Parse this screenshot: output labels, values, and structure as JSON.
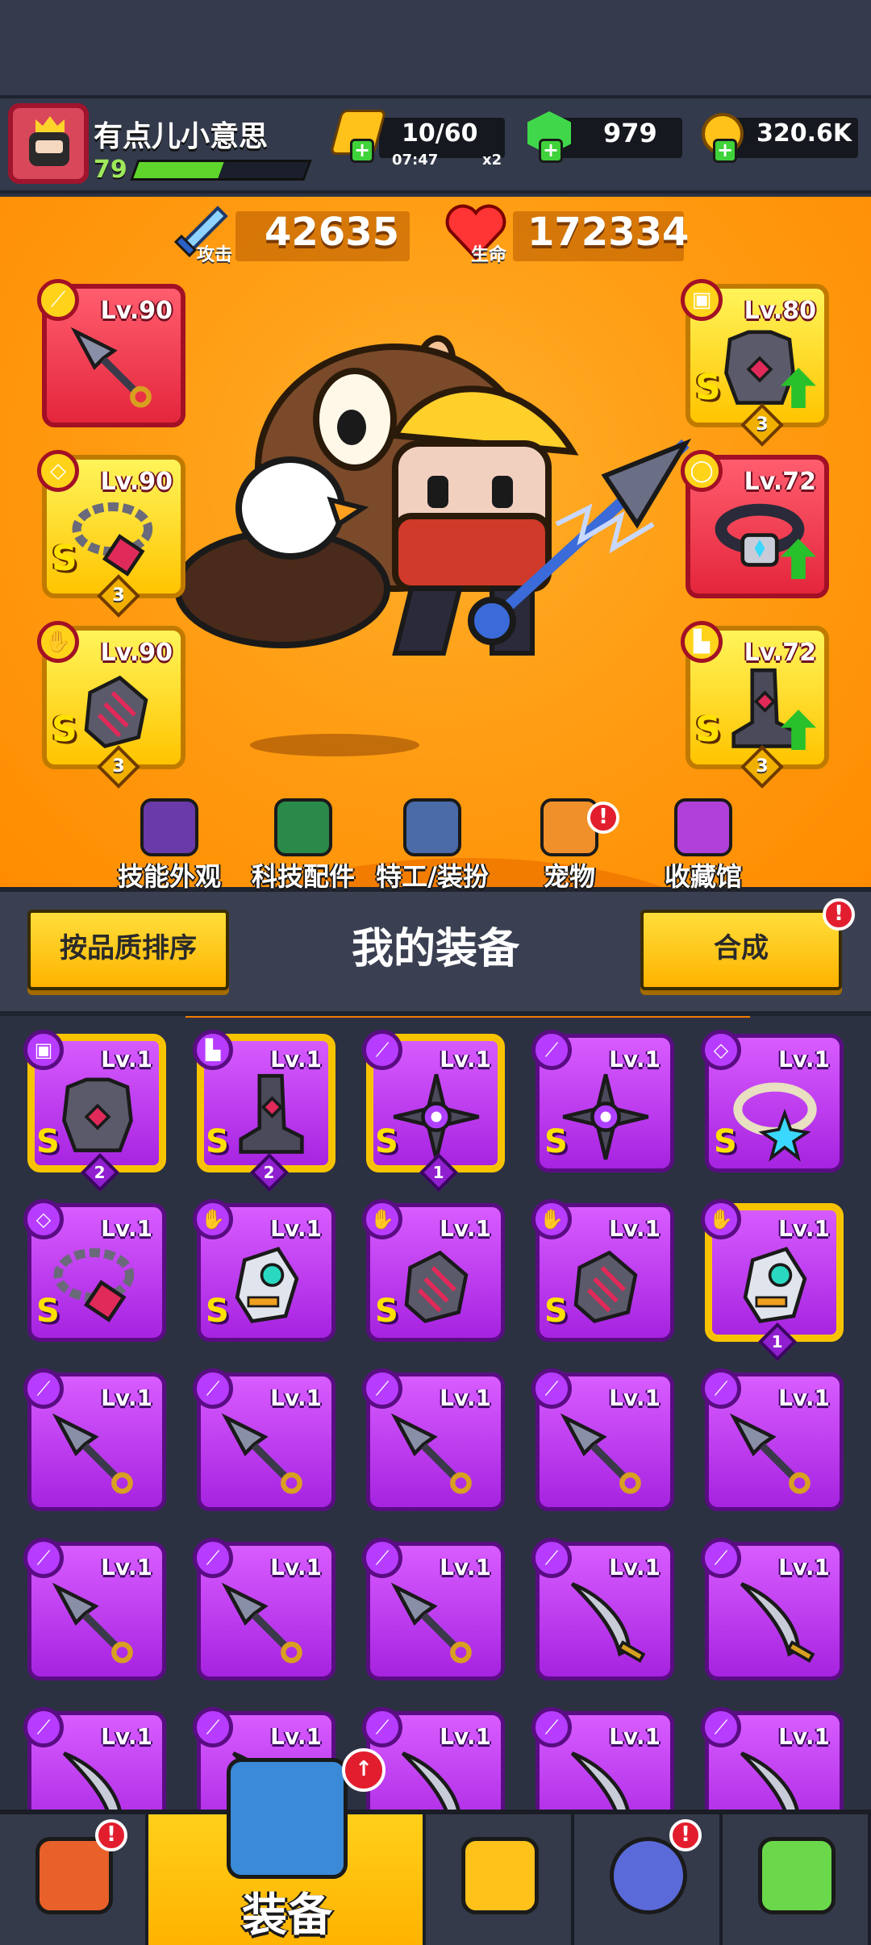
{
  "player": {
    "name": "有点儿小意思",
    "level": "79",
    "xp_fraction": 0.5
  },
  "resources": {
    "energy": {
      "value": "10/60",
      "timer": "07:47",
      "multiplier": "x2"
    },
    "gems": {
      "value": "979"
    },
    "coins": {
      "value": "320.6K"
    }
  },
  "stats": {
    "attack": {
      "label": "攻击",
      "value": "42635"
    },
    "health": {
      "label": "生命",
      "value": "172334"
    }
  },
  "equipped": {
    "left": [
      {
        "level": "Lv.90",
        "item": "kunai",
        "grade": "",
        "count": ""
      },
      {
        "level": "Lv.90",
        "item": "necklace",
        "grade": "S",
        "count": "3"
      },
      {
        "level": "Lv.90",
        "item": "gloves",
        "grade": "S",
        "count": "3"
      }
    ],
    "right": [
      {
        "level": "Lv.80",
        "item": "armor",
        "grade": "S",
        "count": "3"
      },
      {
        "level": "Lv.72",
        "item": "belt",
        "grade": "",
        "count": ""
      },
      {
        "level": "Lv.72",
        "item": "boots",
        "grade": "S",
        "count": "3"
      }
    ]
  },
  "menu": [
    {
      "label": "技能外观",
      "icon": "wizard-hat-icon"
    },
    {
      "label": "科技配件",
      "icon": "hex-chip-icon"
    },
    {
      "label": "特工/装扮",
      "icon": "agent-icon"
    },
    {
      "label": "宠物",
      "icon": "shiba-dog-icon",
      "alert": "!"
    },
    {
      "label": "收藏馆",
      "icon": "collection-chest-icon"
    }
  ],
  "equipment_panel": {
    "sort_button": "按品质排序",
    "title": "我的装备",
    "merge_button": "合成",
    "merge_alert": "!"
  },
  "inventory": {
    "rows": [
      [
        {
          "level": "Lv.1",
          "item": "armor",
          "grade": "S",
          "count": "2",
          "selected": true
        },
        {
          "level": "Lv.1",
          "item": "boots",
          "grade": "S",
          "count": "2",
          "selected": true
        },
        {
          "level": "Lv.1",
          "item": "shuriken",
          "grade": "S",
          "count": "1",
          "selected": true
        },
        {
          "level": "Lv.1",
          "item": "shuriken",
          "grade": "S",
          "count": "",
          "selected": false
        },
        {
          "level": "Lv.1",
          "item": "ring",
          "grade": "S",
          "count": "",
          "selected": false
        }
      ],
      [
        {
          "level": "Lv.1",
          "item": "necklace",
          "grade": "S",
          "count": "",
          "selected": false
        },
        {
          "level": "Lv.1",
          "item": "mech-glove",
          "grade": "S",
          "count": "",
          "selected": false
        },
        {
          "level": "Lv.1",
          "item": "gloves",
          "grade": "S",
          "count": "",
          "selected": false
        },
        {
          "level": "Lv.1",
          "item": "gloves",
          "grade": "S",
          "count": "",
          "selected": false
        },
        {
          "level": "Lv.1",
          "item": "mech-glove",
          "grade": "",
          "count": "1",
          "selected": true
        }
      ],
      [
        {
          "level": "Lv.1",
          "item": "kunai",
          "grade": "",
          "count": "",
          "selected": false
        },
        {
          "level": "Lv.1",
          "item": "kunai",
          "grade": "",
          "count": "",
          "selected": false
        },
        {
          "level": "Lv.1",
          "item": "kunai",
          "grade": "",
          "count": "",
          "selected": false
        },
        {
          "level": "Lv.1",
          "item": "kunai",
          "grade": "",
          "count": "",
          "selected": false
        },
        {
          "level": "Lv.1",
          "item": "kunai",
          "grade": "",
          "count": "",
          "selected": false
        }
      ],
      [
        {
          "level": "Lv.1",
          "item": "kunai",
          "grade": "",
          "count": "",
          "selected": false
        },
        {
          "level": "Lv.1",
          "item": "kunai",
          "grade": "",
          "count": "",
          "selected": false
        },
        {
          "level": "Lv.1",
          "item": "kunai",
          "grade": "",
          "count": "",
          "selected": false
        },
        {
          "level": "Lv.1",
          "item": "sword",
          "grade": "",
          "count": "",
          "selected": false
        },
        {
          "level": "Lv.1",
          "item": "sword",
          "grade": "",
          "count": "",
          "selected": false
        }
      ],
      [
        {
          "level": "Lv.1",
          "item": "sword",
          "grade": "",
          "count": "",
          "selected": false
        },
        {
          "level": "Lv.1",
          "item": "sword",
          "grade": "",
          "count": "",
          "selected": false
        },
        {
          "level": "Lv.1",
          "item": "sword",
          "grade": "",
          "count": "",
          "selected": false
        },
        {
          "level": "Lv.1",
          "item": "sword",
          "grade": "",
          "count": "",
          "selected": false
        },
        {
          "level": "Lv.1",
          "item": "sword",
          "grade": "",
          "count": "",
          "selected": false
        }
      ]
    ]
  },
  "bottom_nav": [
    {
      "label": "",
      "icon": "shop-icon",
      "alert": "!",
      "active": false
    },
    {
      "label": "装备",
      "icon": "equipment-icon",
      "alert": "↑",
      "active": true
    },
    {
      "label": "",
      "icon": "star-swords-icon",
      "alert": "",
      "active": false
    },
    {
      "label": "",
      "icon": "planet-icon",
      "alert": "!",
      "active": false
    },
    {
      "label": "",
      "icon": "dna-capsule-icon",
      "alert": "",
      "active": false
    }
  ],
  "colors": {
    "stage": "#ff9a10",
    "epic": "#b73cff",
    "legendary_red": "#e4263c",
    "gold": "#ffc400"
  }
}
